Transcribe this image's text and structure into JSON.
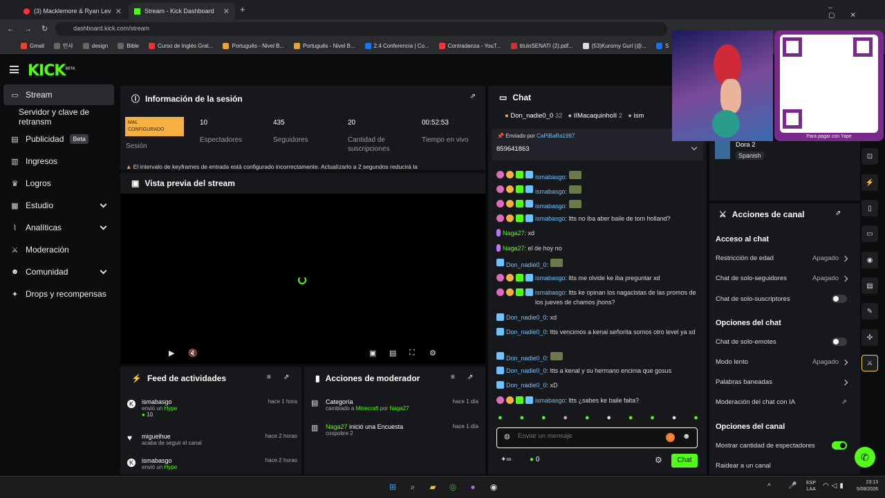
{
  "browser": {
    "tabs": [
      {
        "label": "(3) Macklemore & Ryan Lev"
      },
      {
        "label": "Stream - Kick Dashboard"
      }
    ],
    "url": "dashboard.kick.com/stream",
    "bookmarks": [
      "Gmail",
      "인사",
      "design",
      "Bible",
      "Curso de Inglés Grat...",
      "Português - Nivel B...",
      "Português - Nivel B...",
      "2.4 Conferencia | Co...",
      "Contradanza - YouT...",
      "tituloSENATI (2).pdf...",
      "(53)Kurorny Gurl (@...",
      "S"
    ]
  },
  "logo": "KICK",
  "logo_sup": "BETA",
  "sidebar": {
    "items": [
      {
        "label": "Stream"
      },
      {
        "label": "Servidor y clave de retransm"
      },
      {
        "label": "Publicidad",
        "badge": "Beta"
      },
      {
        "label": "Ingresos"
      },
      {
        "label": "Logros"
      },
      {
        "label": "Estudio"
      },
      {
        "label": "Analíticas"
      },
      {
        "label": "Moderación"
      },
      {
        "label": "Comunidad"
      },
      {
        "label": "Drops y recompensas"
      }
    ]
  },
  "session": {
    "title": "Información de la sesión",
    "rating_line1": "MAL",
    "rating_line2": "CONFIGURADO",
    "rating_label": "Sesión",
    "stats": [
      {
        "value": "10",
        "label": "Espectadores"
      },
      {
        "value": "435",
        "label": "Seguidores"
      },
      {
        "value": "20",
        "label": "Cantidad de suscripciones"
      },
      {
        "value": "00:52:53",
        "label": "Tiempo en vivo"
      }
    ],
    "warning": "El intervalo de keyframes de entrada está configurado incorrectamente. Actualízarlo a 2 segundos reducirá la"
  },
  "preview": {
    "title": "Vista previa del stream"
  },
  "feed": {
    "title": "Feed de actividades",
    "items": [
      {
        "user": "ismabasgo",
        "time": "hace 1 hora",
        "line_pre": "envió un",
        "line_hl": "Hype",
        "amount": "10"
      },
      {
        "user": "miguelhue",
        "time": "hace 2 horas",
        "line_pre": "acaba de seguir el canal"
      },
      {
        "user": "ismabasgo",
        "time": "hace 2 horas",
        "line_pre": "envió un",
        "line_hl": "Hype"
      }
    ]
  },
  "modactions": {
    "title": "Acciones de moderador",
    "items": [
      {
        "title": "Categoría",
        "time": "hace 1 día",
        "pre": "cambiado a",
        "hl": "Minecraft",
        "mid": "por",
        "hl2": "Naga27"
      },
      {
        "title_hl": "Naga27",
        "title": "inició una Encuesta",
        "time": "hace 1 día",
        "pre": "cospobre 2"
      }
    ]
  },
  "chat": {
    "title": "Chat",
    "top_gifters": [
      {
        "name": "Don_nadie0_0",
        "count": "32"
      },
      {
        "name": "IIMacaquinhoII",
        "count": "2"
      },
      {
        "name": "ism"
      }
    ],
    "pinned_by_label": "Enviado por",
    "pinned_by": "CaPiBaRa1997",
    "pinned_text": "859641863",
    "messages": [
      {
        "user": "ismabasgo",
        "text": "",
        "emote": true
      },
      {
        "user": "ismabasgo",
        "text": "",
        "emote": true
      },
      {
        "user": "ismabasgo",
        "text": "",
        "emote": true
      },
      {
        "user": "ismabasgo",
        "text": "ltts no iba aber baile de tom holland?"
      },
      {
        "user": "Naga27",
        "text": "xd"
      },
      {
        "user": "Naga27",
        "text": "el de hoy no"
      },
      {
        "user": "Don_nadie0_0",
        "text": "",
        "emote": true
      },
      {
        "user": "ismabasgo",
        "text": "ltts me olvide ke iba preguntar xd"
      },
      {
        "user": "ismabasgo",
        "text": "ltts ke opinan los nagacistas de las promos de los jueves de chamos jhons?"
      },
      {
        "user": "Don_nadie0_0",
        "text": "xd"
      },
      {
        "user": "Don_nadie0_0",
        "text": "ltts vencimos a kenai señorita somos otro level ya xd"
      },
      {
        "user": "Don_nadie0_0",
        "text": "",
        "emote": true
      },
      {
        "user": "Don_nadie0_0",
        "text": "ltts a kenal y su hermano encima que gosus"
      },
      {
        "user": "Don_nadie0_0",
        "text": "xD"
      },
      {
        "user": "ismabasgo",
        "text": "ltts ¿sabes ke baile falta?"
      }
    ],
    "input_placeholder": "Enviar un mensaje",
    "points": "0",
    "send_label": "Chat"
  },
  "stream_info": {
    "category": "Dora 2",
    "language": "Spanish"
  },
  "qr": {
    "caption": "Para pagar con Yape"
  },
  "channel_actions": {
    "title": "Acciones de canal",
    "sections": [
      {
        "title": "Acceso al chat",
        "rows": [
          {
            "label": "Restricción de edad",
            "value": "Apagado"
          },
          {
            "label": "Chat de solo-seguidores",
            "value": "Apagado"
          },
          {
            "label": "Chat de solo-suscriptores",
            "toggle": false
          }
        ]
      },
      {
        "title": "Opciones del chat",
        "rows": [
          {
            "label": "Chat de solo-emotes",
            "toggle": false
          },
          {
            "label": "Modo lento",
            "value": "Apagado"
          },
          {
            "label": "Palabras baneadas"
          },
          {
            "label": "Moderación del chat con IA"
          }
        ]
      },
      {
        "title": "Opciones del canal",
        "rows": [
          {
            "label": "Mostrar cantidad de espectadores",
            "toggle": true
          },
          {
            "label": "Raidear a un canal"
          }
        ]
      }
    ]
  },
  "taskbar": {
    "lang1": "ESP",
    "lang2": "LAA",
    "time": "23:13",
    "date": "5/08/2026"
  },
  "colors": {
    "accent": "#53fc18",
    "panel": "#17181c",
    "warning": "#f5b041"
  }
}
